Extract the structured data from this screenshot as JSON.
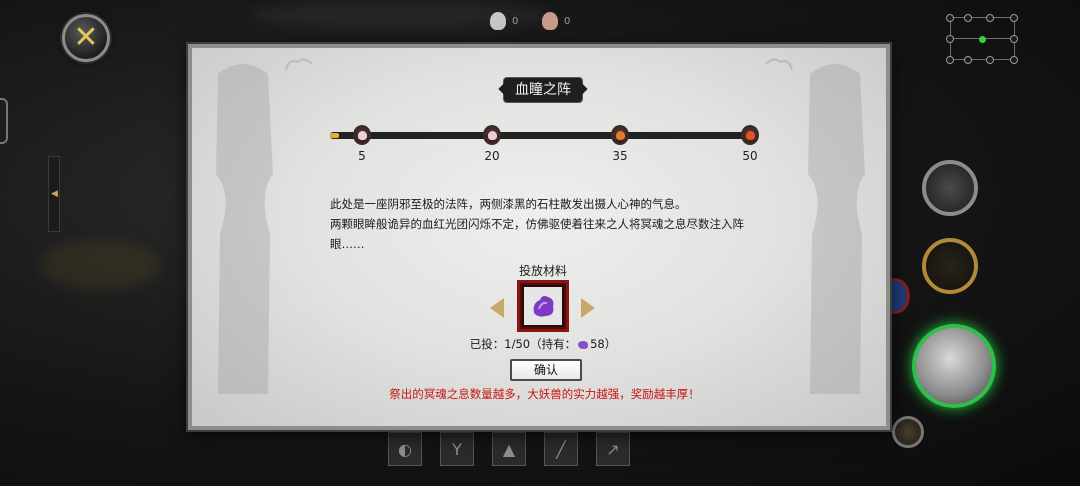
{
  "window": {
    "title": "血瞳之阵",
    "close_icon": "close-x-icon"
  },
  "hud": {
    "top_counters": [
      "0",
      "0"
    ],
    "minimap_icon": "minimap-icon"
  },
  "progress": {
    "current": 1,
    "max": 50,
    "fill_fraction": 0.02,
    "milestones": [
      {
        "label": "5",
        "icon": "skull-icon",
        "color": "#e7d5d5"
      },
      {
        "label": "20",
        "icon": "skull-icon",
        "color": "#e7cfcf"
      },
      {
        "label": "35",
        "icon": "flaming-skull-icon",
        "color": "#e07a2c"
      },
      {
        "label": "50",
        "icon": "flaming-skull-icon",
        "color": "#e0561c"
      }
    ]
  },
  "description": {
    "line1": "此处是一座阴邪至极的法阵，两侧漆黑的石柱散发出摄人心神的气息。",
    "line2": "两颗眼眸般诡异的血红光团闪烁不定，仿佛驱使着往来之人将冥魂之息尽数注入阵眼……"
  },
  "material": {
    "label": "投放材料",
    "item_icon": "purple-soul-essence-icon",
    "prev_icon": "arrow-left-icon",
    "next_icon": "arrow-right-icon"
  },
  "invested": {
    "prefix": "已投：1/50（持有：",
    "count": "58",
    "suffix": "）"
  },
  "confirm": {
    "label": "确认"
  },
  "warning": "祭出的冥魂之息数量越多，大妖兽的实力越强，奖励越丰厚！",
  "colors": {
    "accent_gold": "#e0b23a",
    "warning_red": "#c81414",
    "item_frame": "#8e1212"
  }
}
